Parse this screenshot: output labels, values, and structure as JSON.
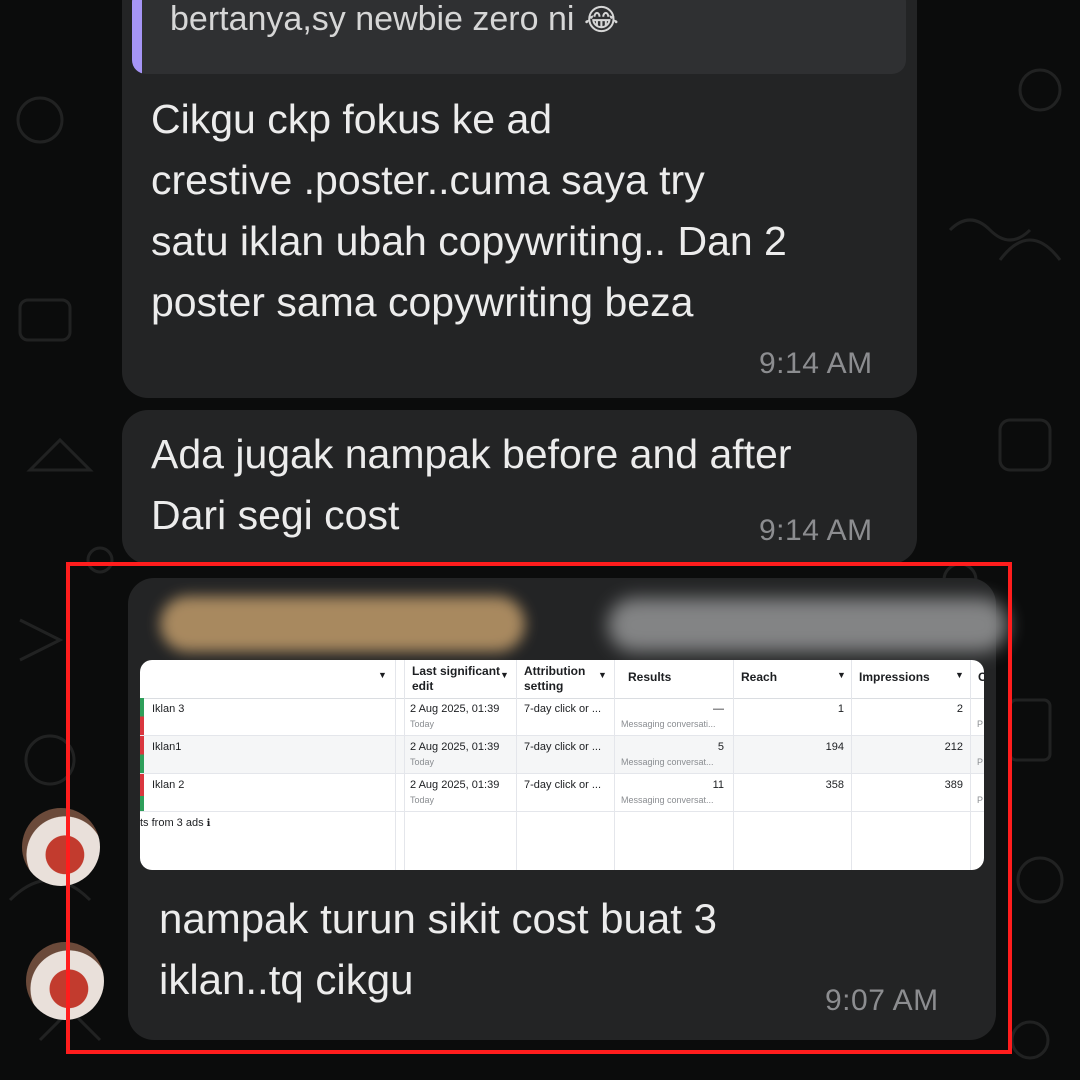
{
  "quote": {
    "text": "bertanya,sy newbie zero ni",
    "emoji": "😂"
  },
  "messages": [
    {
      "text": "Cikgu ckp fokus ke ad\ncrestive .poster..cuma saya try\nsatu iklan ubah copywriting.. Dan 2\nposter sama copywriting beza",
      "time": "9:14 AM"
    },
    {
      "text": "Ada jugak nampak before and after\nDari segi cost",
      "time": "9:14 AM"
    },
    {
      "text": "nampak turun sikit cost buat 3\niklan..tq cikgu",
      "time": "9:07 AM"
    }
  ],
  "table": {
    "headers": {
      "last_edit_line1": "Last significant",
      "last_edit_line2": "edit",
      "attribution_line1": "Attribution",
      "attribution_line2": "setting",
      "results": "Results",
      "reach": "Reach",
      "impressions": "Impressions",
      "cut": "C"
    },
    "rows": [
      {
        "name": "Iklan 3",
        "date": "2 Aug 2025, 01:39",
        "date_sub": "Today",
        "attribution": "7-day click or ...",
        "result": "—",
        "result_sub": "Messaging conversati...",
        "reach": "1",
        "impressions": "2",
        "tail": "P"
      },
      {
        "name": "Iklan1",
        "date": "2 Aug 2025, 01:39",
        "date_sub": "Today",
        "attribution": "7-day click or ...",
        "result": "5",
        "result_sub": "Messaging conversat...",
        "reach": "194",
        "impressions": "212",
        "tail": "P"
      },
      {
        "name": "Iklan 2",
        "date": "2 Aug 2025, 01:39",
        "date_sub": "Today",
        "attribution": "7-day click or ...",
        "result": "11",
        "result_sub": "Messaging conversat...",
        "reach": "358",
        "impressions": "389",
        "tail": "P"
      }
    ],
    "footer": "ts from 3 ads",
    "info_icon": "ℹ",
    "caret": "▼"
  },
  "colors": {
    "background": "#0b0c0c",
    "bubble": "#232425",
    "quote_bar": "#a695f5",
    "highlight": "#ff1d1d",
    "row_mark_green": "#2e9f5a",
    "row_mark_red": "#d9363e"
  }
}
